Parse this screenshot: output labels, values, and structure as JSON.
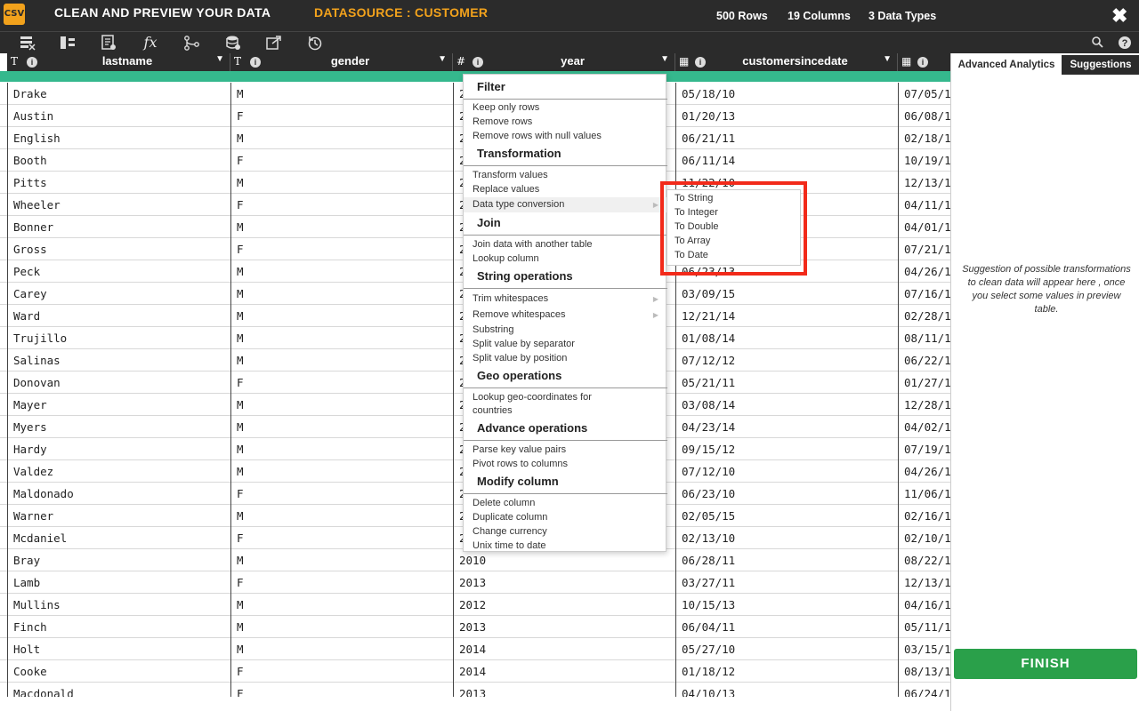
{
  "header": {
    "logo": "CSV",
    "title": "CLEAN AND PREVIEW YOUR DATA",
    "datasource": "DATASOURCE : CUSTOMER",
    "rows": "500 Rows",
    "columns": "19 Columns",
    "types": "3 Data Types",
    "close": "✖"
  },
  "toolbar": {
    "icons": [
      "filter-grid-icon",
      "columns-icon",
      "document-icon",
      "function-icon",
      "branch-icon",
      "database-icon",
      "export-icon",
      "history-icon",
      "search-icon",
      "help-icon"
    ]
  },
  "columns": [
    {
      "type": "T",
      "name": "lastname"
    },
    {
      "type": "T",
      "name": "gender"
    },
    {
      "type": "#",
      "name": "year"
    },
    {
      "type": "▦",
      "name": "customersincedate"
    },
    {
      "type": "▦",
      "name": ""
    }
  ],
  "rows": [
    [
      "Drake",
      "M",
      "2",
      "05/18/10",
      "07/05/1"
    ],
    [
      "Austin",
      "F",
      "2",
      "01/20/13",
      "06/08/1"
    ],
    [
      "English",
      "M",
      "2",
      "06/21/11",
      "02/18/1"
    ],
    [
      "Booth",
      "F",
      "2",
      "06/11/14",
      "10/19/1"
    ],
    [
      "Pitts",
      "M",
      "2",
      "11/22/10",
      "12/13/1"
    ],
    [
      "Wheeler",
      "F",
      "2",
      "",
      "04/11/1"
    ],
    [
      "Bonner",
      "M",
      "2",
      "",
      "04/01/1"
    ],
    [
      "Gross",
      "F",
      "2",
      "",
      "07/21/1"
    ],
    [
      "Peck",
      "M",
      "2",
      "06/23/13",
      "04/26/1"
    ],
    [
      "Carey",
      "M",
      "2",
      "03/09/15",
      "07/16/1"
    ],
    [
      "Ward",
      "M",
      "2",
      "12/21/14",
      "02/28/1"
    ],
    [
      "Trujillo",
      "M",
      "2",
      "01/08/14",
      "08/11/1"
    ],
    [
      "Salinas",
      "M",
      "2",
      "07/12/12",
      "06/22/1"
    ],
    [
      "Donovan",
      "F",
      "2",
      "05/21/11",
      "01/27/1"
    ],
    [
      "Mayer",
      "M",
      "2",
      "03/08/14",
      "12/28/1"
    ],
    [
      "Myers",
      "M",
      "2",
      "04/23/14",
      "04/02/1"
    ],
    [
      "Hardy",
      "M",
      "2",
      "09/15/12",
      "07/19/1"
    ],
    [
      "Valdez",
      "M",
      "2",
      "07/12/10",
      "04/26/1"
    ],
    [
      "Maldonado",
      "F",
      "2",
      "06/23/10",
      "11/06/1"
    ],
    [
      "Warner",
      "M",
      "2",
      "02/05/15",
      "02/16/1"
    ],
    [
      "Mcdaniel",
      "F",
      "2",
      "02/13/10",
      "02/10/1"
    ],
    [
      "Bray",
      "M",
      "2010",
      "06/28/11",
      "08/22/1"
    ],
    [
      "Lamb",
      "F",
      "2013",
      "03/27/11",
      "12/13/1"
    ],
    [
      "Mullins",
      "M",
      "2012",
      "10/15/13",
      "04/16/1"
    ],
    [
      "Finch",
      "M",
      "2013",
      "06/04/11",
      "05/11/1"
    ],
    [
      "Holt",
      "M",
      "2014",
      "05/27/10",
      "03/15/1"
    ],
    [
      "Cooke",
      "F",
      "2014",
      "01/18/12",
      "08/13/1"
    ],
    [
      "Macdonald",
      "F",
      "2013",
      "04/10/13",
      "06/24/1"
    ]
  ],
  "menu": {
    "sections": [
      {
        "title": "Filter",
        "items": [
          "Keep only rows",
          "Remove rows",
          "Remove rows with null values"
        ]
      },
      {
        "title": "Transformation",
        "items": [
          "Transform values",
          "Replace values",
          "Data type conversion"
        ]
      },
      {
        "title": "Join",
        "items": [
          "Join data with another table",
          "Lookup column"
        ]
      },
      {
        "title": "String operations",
        "items": [
          "Trim whitespaces",
          "Remove whitespaces",
          "Substring",
          "Split value by separator",
          "Split value by position"
        ]
      },
      {
        "title": "Geo operations",
        "items": [
          "Lookup geo-coordinates for",
          "countries"
        ]
      },
      {
        "title": "Advance operations",
        "items": [
          "Parse key value pairs",
          "Pivot rows to columns"
        ]
      },
      {
        "title": "Modify column",
        "items": [
          "Delete column",
          "Duplicate column",
          "Change currency",
          "Unix time to date"
        ]
      }
    ]
  },
  "submenu": [
    "To String",
    "To Integer",
    "To Double",
    "To Array",
    "To Date"
  ],
  "sidebar": {
    "tab_analytics": "Advanced Analytics",
    "tab_suggestions": "Suggestions",
    "suggestion_text": "Suggestion of possible transformations to clean data will appear here , once you select some values in preview table.",
    "finish": "FINISH"
  },
  "colors": {
    "accent": "#f2a21c",
    "green": "#35b88d",
    "finish": "#2aa04a",
    "highlight": "#f22a1a"
  }
}
